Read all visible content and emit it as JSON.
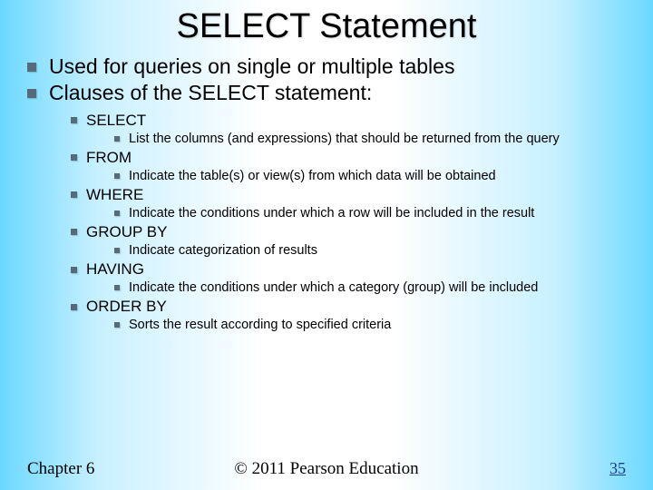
{
  "title": "SELECT Statement",
  "bullets": [
    {
      "text": "Used for queries on single or multiple tables"
    },
    {
      "text": "Clauses of the SELECT statement:"
    }
  ],
  "clauses": [
    {
      "name": "SELECT",
      "desc": "List the columns (and expressions) that should be returned from the query"
    },
    {
      "name": "FROM",
      "desc": "Indicate the table(s) or view(s) from which data will be obtained"
    },
    {
      "name": "WHERE",
      "desc": "Indicate the conditions under which a row will be included in the result"
    },
    {
      "name": "GROUP BY",
      "desc": "Indicate categorization of results"
    },
    {
      "name": "HAVING",
      "desc": "Indicate the conditions under which a category (group) will be included"
    },
    {
      "name": "ORDER BY",
      "desc": "Sorts the result according to specified criteria"
    }
  ],
  "footer": {
    "left": "Chapter 6",
    "center": "© 2011 Pearson Education",
    "right": "35"
  }
}
